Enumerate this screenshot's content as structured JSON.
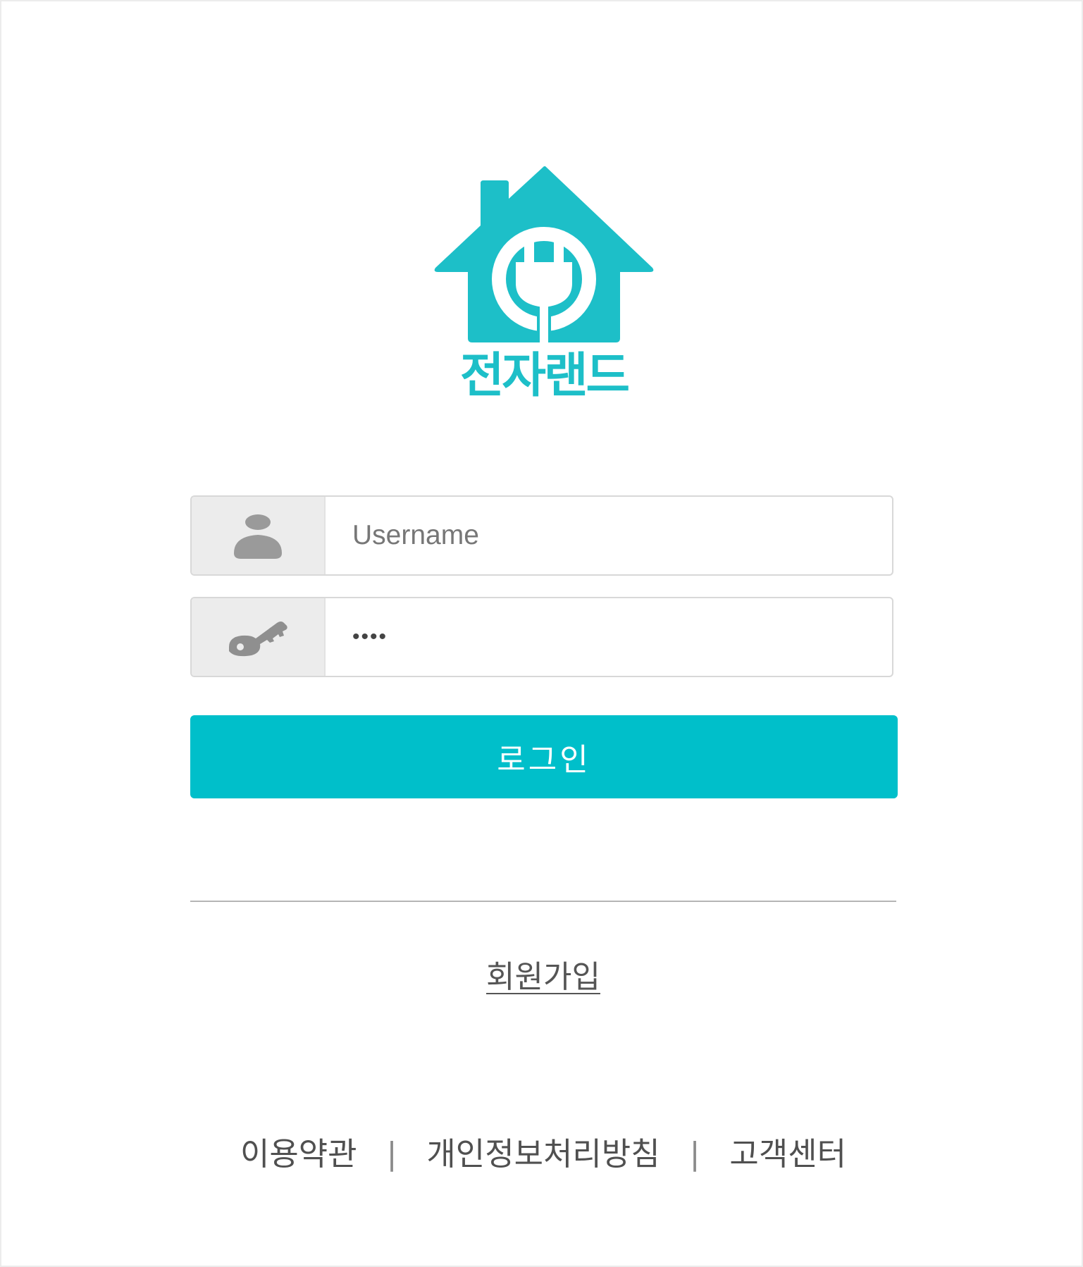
{
  "brand": {
    "name": "전자랜드",
    "color": "#1dbfc8"
  },
  "form": {
    "username": {
      "placeholder": "Username",
      "value": "",
      "icon": "user-icon"
    },
    "password": {
      "value": "••••",
      "icon": "key-icon"
    },
    "login_label": "로그인",
    "login_color": "#00bfca"
  },
  "signup_label": "회원가입",
  "footer": {
    "terms": "이용약관",
    "separator": "|",
    "privacy": "개인정보처리방침",
    "support": "고객센터"
  }
}
